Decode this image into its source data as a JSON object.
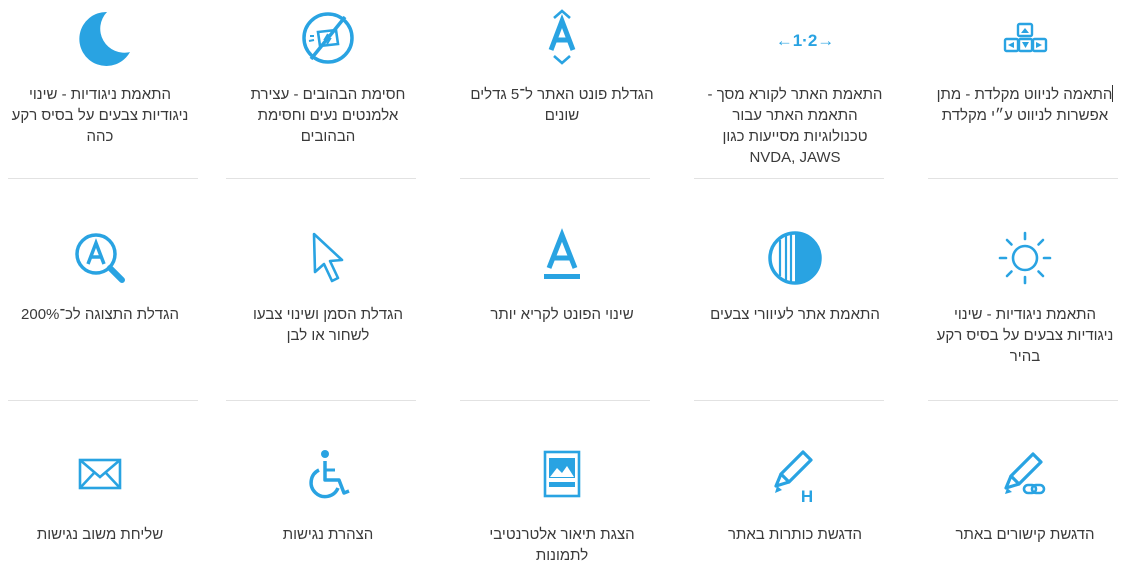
{
  "accent_color": "#29a3e2",
  "features": [
    {
      "id": "keyboard-nav",
      "icon": "keyboard-arrows-icon",
      "label": "התאמה לניווט מקלדת - מתן אפשרות לניווט ע״י מקלדת"
    },
    {
      "id": "screen-reader",
      "icon": "screen-reader-icon",
      "icon_text": "←1·2→",
      "label": "התאמת האתר לקורא מסך - התאמת האתר עבור טכנולוגיות מסייעות כגון NVDA, JAWS"
    },
    {
      "id": "font-enlarge",
      "icon": "font-enlarge-icon",
      "label": "הגדלת פונט האתר ל־5 גדלים שונים"
    },
    {
      "id": "stop-flashing",
      "icon": "stop-flashing-icon",
      "label": "חסימת הבהובים - עצירת אלמנטים נעים וחסימת הבהובים"
    },
    {
      "id": "dark-contrast",
      "icon": "moon-icon",
      "label": "התאמת ניגודיות - שינוי ניגודיות צבעים על בסיס רקע כהה"
    },
    {
      "id": "light-contrast",
      "icon": "sun-icon",
      "label": "התאמת ניגודיות - שינוי ניגודיות צבעים על בסיס רקע בהיר"
    },
    {
      "id": "color-blind",
      "icon": "contrast-circle-icon",
      "label": "התאמת אתר לעיוורי צבעים"
    },
    {
      "id": "readable-font",
      "icon": "font-underline-icon",
      "label": "שינוי הפונט לקריא יותר"
    },
    {
      "id": "cursor-change",
      "icon": "cursor-arrow-icon",
      "label": "הגדלת הסמן ושינוי צבעו לשחור או לבן"
    },
    {
      "id": "zoom",
      "icon": "magnifier-icon",
      "label": "הגדלת התצוגה לכ־200%"
    },
    {
      "id": "highlight-links",
      "icon": "marker-link-icon",
      "label": "הדגשת קישורים באתר"
    },
    {
      "id": "highlight-headings",
      "icon": "marker-heading-icon",
      "icon_text": "H",
      "label": "הדגשת כותרות באתר"
    },
    {
      "id": "alt-text",
      "icon": "image-icon",
      "label": "הצגת תיאור אלטרנטיבי לתמונות"
    },
    {
      "id": "accessibility-statement",
      "icon": "wheelchair-icon",
      "label": "הצהרת נגישות"
    },
    {
      "id": "feedback",
      "icon": "envelope-icon",
      "label": "שליחת משוב נגישות"
    }
  ]
}
